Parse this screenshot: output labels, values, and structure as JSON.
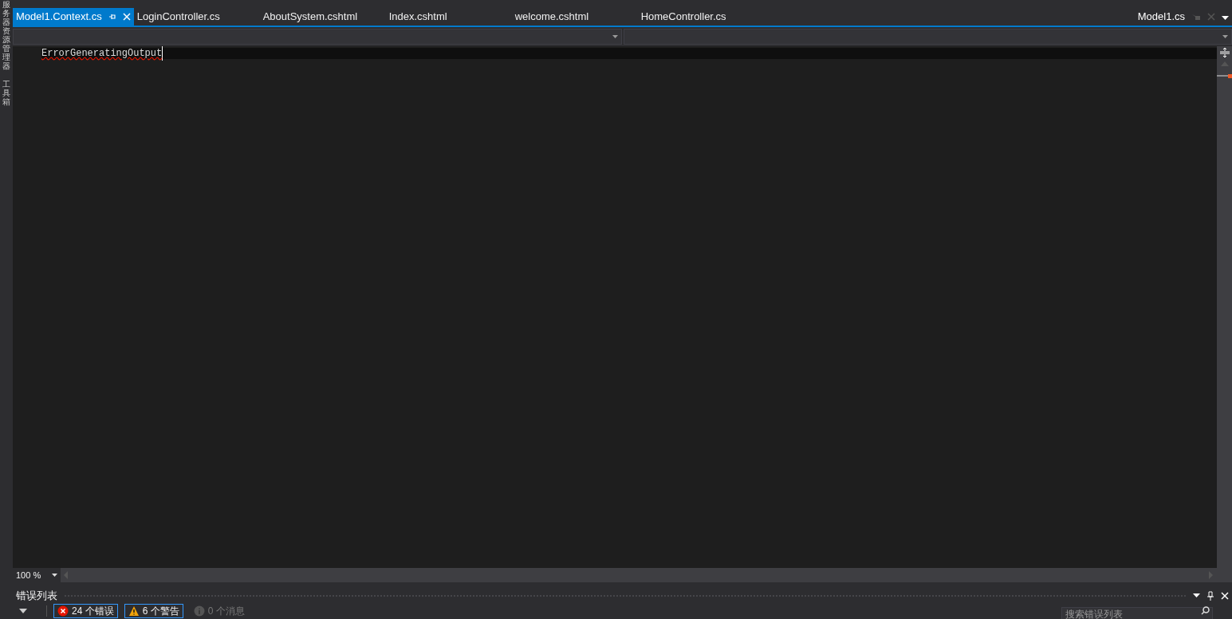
{
  "side_tabs": [
    {
      "label": "服务器资源管理器"
    },
    {
      "label": "工具箱"
    }
  ],
  "tabs": [
    {
      "label": "Model1.Context.cs",
      "selected": true
    },
    {
      "label": "LoginController.cs",
      "selected": false
    },
    {
      "label": "AboutSystem.cshtml",
      "selected": false
    },
    {
      "label": "Index.cshtml",
      "selected": false
    },
    {
      "label": "welcome.cshtml",
      "selected": false
    },
    {
      "label": "HomeController.cs",
      "selected": false
    }
  ],
  "preview_tab": {
    "label": "Model1.cs"
  },
  "editor": {
    "lines": [
      "ErrorGeneratingOutput"
    ]
  },
  "zoom": {
    "value": "100 %"
  },
  "error_list": {
    "title": "错误列表",
    "filters": [
      {
        "kind": "error",
        "label": "24 个错误",
        "selected": true
      },
      {
        "kind": "warning",
        "label": "6 个警告",
        "selected": true
      },
      {
        "kind": "message",
        "label": "0 个消息",
        "selected": false
      }
    ],
    "search": {
      "placeholder": "搜索错误列表"
    }
  }
}
